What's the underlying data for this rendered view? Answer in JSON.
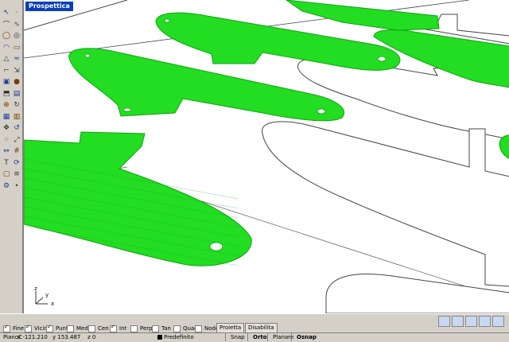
{
  "viewport": {
    "title": "Prospettica",
    "part_color": "#22dd22",
    "part_edge_color": "#11a311"
  },
  "toolbar": {
    "icons": [
      "select-arrow-icon",
      "point-icon",
      "polyline-icon",
      "curve-icon",
      "circle-icon",
      "ellipse-icon",
      "arc-icon",
      "rectangle-icon",
      "polygon-icon",
      "freeform-icon",
      "fillet-icon",
      "offset-icon",
      "box-icon",
      "sphere-icon",
      "extrude-icon",
      "surface-icon",
      "boolean-icon",
      "sweep-icon",
      "mesh-icon",
      "cap-icon",
      "move-icon",
      "rotate-icon",
      "array-icon",
      "scale-icon",
      "dimension-icon",
      "grid-icon",
      "text-icon",
      "rebuild-icon",
      "group-icon",
      "layer-icon",
      "properties-icon",
      "misc-icon"
    ]
  },
  "osnap": {
    "items": [
      {
        "label": "Fine",
        "checked": true
      },
      {
        "label": "Vicino",
        "checked": true
      },
      {
        "label": "Punto",
        "checked": true
      },
      {
        "label": "Medio",
        "checked": false
      },
      {
        "label": "Cen",
        "checked": false
      },
      {
        "label": "Int",
        "checked": true
      },
      {
        "label": "Perp",
        "checked": false
      },
      {
        "label": "Tan",
        "checked": false
      },
      {
        "label": "Quad",
        "checked": false
      },
      {
        "label": "Nodo",
        "checked": false
      }
    ],
    "project_label": "Proietta",
    "disable_label": "Disabilita"
  },
  "status": {
    "cplane": "PianoC",
    "x": "x -121.210",
    "y": "y 153.487",
    "z": "z 0",
    "layer": "Predefinito",
    "snap": "Snap",
    "ortho": "Orto",
    "planar": "Planare",
    "osnap": "Osnap"
  },
  "axis": {
    "x": "x",
    "y": "y",
    "z": "z"
  }
}
